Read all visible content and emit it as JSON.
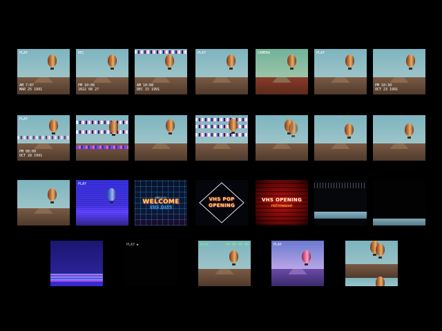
{
  "grid": {
    "row1": [
      {
        "osd_tl": "PLAY",
        "osd_bl": "AM 7:07\nMAR 25 1991"
      },
      {
        "osd_tl": "REC",
        "osd_bl": "PM 10:06\n2022 08 27"
      },
      {
        "osd_tl": "",
        "osd_bl": "AM 10:08\nDEC 15 1991"
      },
      {
        "osd_tl": "PLAY",
        "osd_bl": ""
      },
      {
        "osd_tl": "CAMERA",
        "osd_bl": ""
      },
      {
        "osd_tl": "PLAY",
        "osd_bl": ""
      },
      {
        "osd_tl": "",
        "osd_bl": "PM 10:30\nOCT 23 1991"
      }
    ],
    "row2": [
      {
        "osd_tl": "PLAY",
        "osd_bl": "PM 08:00\nOCT 28 1991"
      },
      {
        "osd_tl": "",
        "osd_bl": ""
      },
      {
        "osd_tl": "",
        "osd_bl": ""
      },
      {
        "osd_tl": "",
        "osd_bl": ""
      },
      {
        "osd_tl": "",
        "osd_bl": ""
      },
      {
        "osd_tl": "",
        "osd_bl": ""
      },
      {
        "osd_tl": "",
        "osd_bl": ""
      }
    ],
    "row3": [
      {
        "osd_tl": "",
        "osd_bl": ""
      },
      {
        "osd_tl": "PLAY",
        "osd_bl": ""
      },
      {
        "title": "WELCOME",
        "pre": "HELLO!",
        "sub": "VHS DAYS"
      },
      {
        "title": "VHS POP\nOPENING"
      },
      {
        "title": "VHS OPENING",
        "sub": "retrowave"
      },
      {
        "osd_tl": "",
        "osd_bl": ""
      },
      {
        "osd_tl": "",
        "osd_bl": ""
      }
    ],
    "row4": [
      {
        "osd_tl": "",
        "osd_bl": ""
      },
      {
        "osd_tl": "PLAY ▶",
        "osd_bl": ""
      },
      {
        "osd_tl": "PLAY",
        "osd_tr": "00 00 00 00"
      },
      {
        "osd_tl": "PLAY",
        "osd_tr": ""
      },
      {
        "osd_tl": "",
        "osd_bl": ""
      }
    ]
  },
  "colors": {
    "background": "#000000",
    "sky": "#7db4bf",
    "ground": "#6b4e3a",
    "neon_yellow": "#ffd35a",
    "neon_cyan": "#4bd7ff",
    "purple": "#3a2bd6"
  }
}
